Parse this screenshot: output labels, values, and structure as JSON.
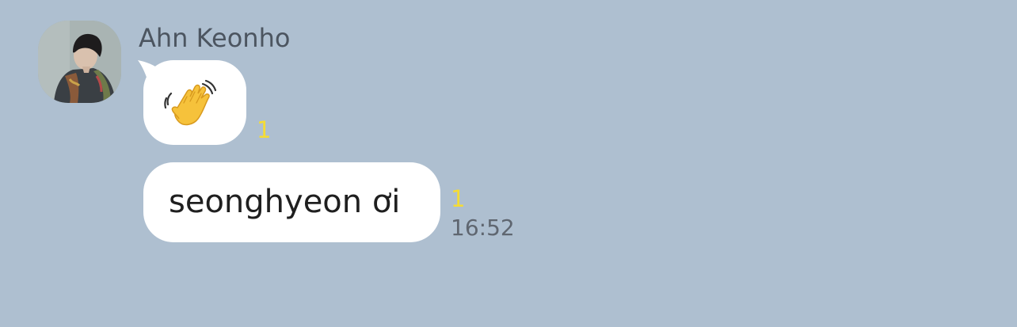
{
  "chat": {
    "sender": {
      "name": "Ahn Keonho",
      "avatar_icon": "profile-photo"
    },
    "messages": [
      {
        "type": "emoji",
        "emoji_icon": "waving-hand-emoji",
        "unread_count": "1"
      },
      {
        "type": "text",
        "text": "seonghyeon ơi",
        "unread_count": "1",
        "time": "16:52"
      }
    ]
  },
  "colors": {
    "background": "#aebfd0",
    "bubble": "#ffffff",
    "unread": "#f5dc34",
    "timestamp": "#5f6670",
    "name": "#4c5560"
  }
}
